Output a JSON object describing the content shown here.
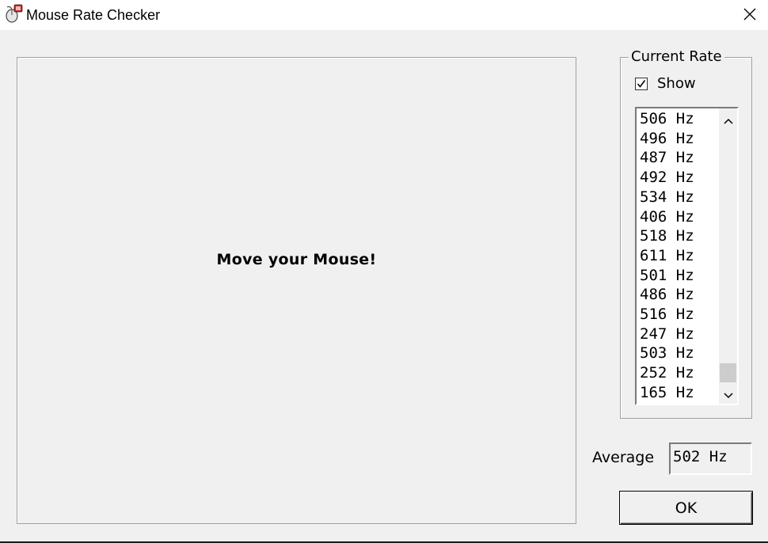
{
  "window": {
    "title": "Mouse Rate Checker"
  },
  "icons": {
    "app": "mouse-app-icon",
    "close": "close-icon",
    "check": "check-icon",
    "scroll_up": "chevron-up-icon",
    "scroll_down": "chevron-down-icon"
  },
  "move_area": {
    "prompt": "Move your Mouse!"
  },
  "current_rate": {
    "group_label": "Current Rate",
    "show_label": "Show",
    "show_checked": true,
    "items": [
      "506 Hz",
      "496 Hz",
      "487 Hz",
      "492 Hz",
      "534 Hz",
      "406 Hz",
      "518 Hz",
      "611 Hz",
      "501 Hz",
      "486 Hz",
      "516 Hz",
      "247 Hz",
      "503 Hz",
      "252 Hz",
      "165 Hz"
    ]
  },
  "average": {
    "label": "Average",
    "value": "502 Hz"
  },
  "buttons": {
    "ok_label": "OK"
  },
  "colors": {
    "window_bg": "#f0f0f0",
    "titlebar_bg": "#ffffff",
    "border": "#a0a0a0",
    "scroll_thumb": "#cdcdcd"
  }
}
